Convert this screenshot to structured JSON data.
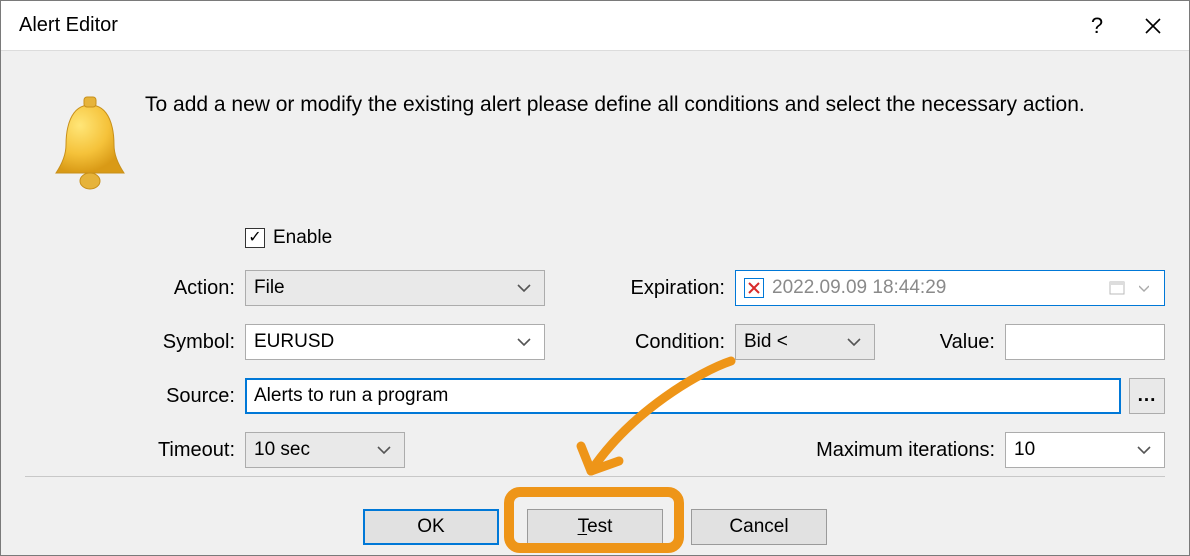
{
  "title": "Alert Editor",
  "intro": "To add a new or modify the existing alert please define all conditions and select the necessary action.",
  "labels": {
    "enable": "Enable",
    "action": "Action:",
    "expiration": "Expiration:",
    "symbol": "Symbol:",
    "condition": "Condition:",
    "value": "Value:",
    "source": "Source:",
    "timeout": "Timeout:",
    "max_iter": "Maximum iterations:"
  },
  "fields": {
    "enable_checked": "✓",
    "action": "File",
    "expiration": "2022.09.09 18:44:29",
    "symbol": "EURUSD",
    "condition": "Bid <",
    "value": "",
    "source": "Alerts to run a program",
    "timeout": "10 sec",
    "max_iter": "10"
  },
  "buttons": {
    "ok": "OK",
    "test_first": "T",
    "test_rest": "est",
    "cancel": "Cancel",
    "browse": "...",
    "help": "?",
    "close": "✕"
  }
}
